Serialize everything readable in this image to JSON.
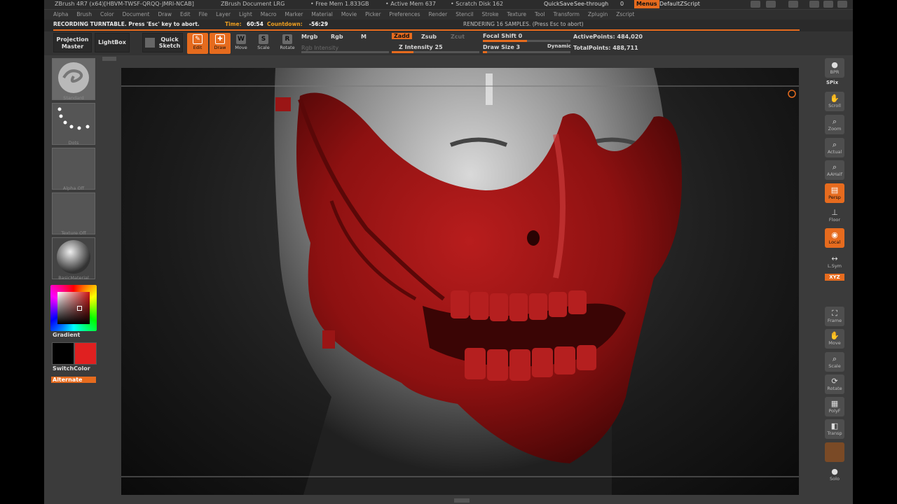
{
  "title_bar": {
    "app": "ZBrush 4R7 (x64)[HBVM-TWSF-QRQQ-JMRI-NCAB]",
    "document": "ZBrush Document LRG",
    "free_mem": "• Free Mem 1.833GB",
    "active_mem": "• Active Mem 637",
    "scratch_disk": "• Scratch Disk 162",
    "quicksave": "QuickSave",
    "see_through": "See-through",
    "see_through_value": "0",
    "menus": "Menus",
    "script": "DefaultZScript"
  },
  "menu_bar": [
    "Alpha",
    "Brush",
    "Color",
    "Document",
    "Draw",
    "Edit",
    "File",
    "Layer",
    "Light",
    "Macro",
    "Marker",
    "Material",
    "Movie",
    "Picker",
    "Preferences",
    "Render",
    "Stencil",
    "Stroke",
    "Texture",
    "Tool",
    "Transform",
    "Zplugin",
    "Zscript"
  ],
  "notice": {
    "recording": "RECORDING TURNTABLE. Press 'Esc' key to abort.",
    "time_label": "Time:",
    "time_value": "60:54",
    "countdown_label": "Countdown:",
    "countdown_value": "-56:29",
    "rendering": "RENDERING 16 SAMPLES. (Press Esc to abort)"
  },
  "toolbar": {
    "projection_master": "Projection Master",
    "lightbox": "LightBox",
    "quick_sketch": "Quick Sketch",
    "tools": [
      {
        "label": "Edit",
        "icon": "edit-icon",
        "active": true
      },
      {
        "label": "Draw",
        "icon": "draw-icon",
        "active": true
      },
      {
        "label": "Move",
        "icon": "move-icon",
        "active": false
      },
      {
        "label": "Scale",
        "icon": "scale-icon",
        "active": false
      },
      {
        "label": "Rotate",
        "icon": "rotate-icon",
        "active": false
      }
    ],
    "mrgb": "Mrgb",
    "rgb": "Rgb",
    "m": "M",
    "rgb_intensity": "Rgb Intensity",
    "zadd": "Zadd",
    "zsub": "Zsub",
    "zcut": "Zcut",
    "z_intensity": "Z Intensity 25",
    "z_intensity_fraction": 0.25,
    "focal_shift": "Focal Shift 0",
    "focal_shift_fraction": 0.5,
    "draw_size": "Draw Size 3",
    "draw_size_fraction": 0.05,
    "dynamic": "Dynamic",
    "active_points": "ActivePoints: 484,020",
    "total_points": "TotalPoints: 488,711"
  },
  "left_tray": {
    "brush_label": "Standard",
    "stroke_label": "Dots",
    "alpha_label": "Alpha Off",
    "texture_label": "Texture Off",
    "material_label": "BasicMaterial",
    "gradient": "Gradient",
    "switch_color": "SwitchColor",
    "alternate": "Alternate",
    "primary_color": "#000000",
    "secondary_color": "#e02020"
  },
  "right_tray": [
    {
      "label": "BPR",
      "icon": "bpr-icon",
      "active": false
    },
    {
      "label": "Scroll",
      "icon": "hand-scroll-icon",
      "active": false
    },
    {
      "label": "Zoom",
      "icon": "zoom-icon",
      "active": false
    },
    {
      "label": "Actual",
      "icon": "actual-size-icon",
      "active": false
    },
    {
      "label": "AAHalf",
      "icon": "aahalf-icon",
      "active": false
    },
    {
      "label": "Persp",
      "icon": "perspective-icon",
      "active": true
    },
    {
      "label": "Floor",
      "icon": "floor-grid-icon",
      "active": false
    },
    {
      "label": "Local",
      "icon": "local-icon",
      "active": true
    },
    {
      "label": "L.Sym",
      "icon": "local-symmetry-icon",
      "active": false
    },
    {
      "label": "Frame",
      "icon": "frame-icon",
      "active": false
    },
    {
      "label": "Move",
      "icon": "move-icon",
      "active": false
    },
    {
      "label": "Scale",
      "icon": "scale-icon",
      "active": false
    },
    {
      "label": "Rotate",
      "icon": "rotate-icon",
      "active": false
    },
    {
      "label": "PolyF",
      "icon": "polyframe-icon",
      "active": false
    },
    {
      "label": "Transp",
      "icon": "transparency-icon",
      "active": false
    },
    {
      "label": "Solo",
      "icon": "solo-icon",
      "active": false
    }
  ],
  "right_tray_extra": {
    "spix": "SPix",
    "xyz": "XYZ"
  }
}
